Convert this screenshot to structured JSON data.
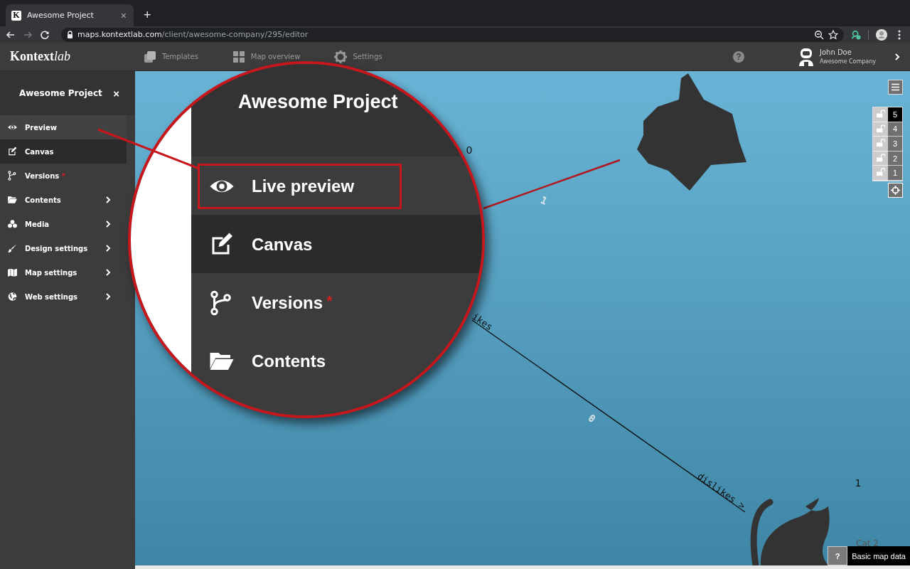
{
  "browser": {
    "tab": {
      "favicon": "K",
      "title": "Awesome Project",
      "close": "×"
    },
    "new_tab": "+",
    "forward_disabled": true,
    "url": {
      "host": "maps.kontextlab.com",
      "path": "/client/awesome-company/295/editor"
    }
  },
  "header": {
    "logo": {
      "main": "Kontext",
      "accent": "lab"
    },
    "nav": [
      {
        "label": "Templates"
      },
      {
        "label": "Map overview"
      },
      {
        "label": "Settings"
      }
    ],
    "help": "?",
    "user": {
      "name": "John Doe",
      "company": "Awesome Company"
    }
  },
  "sidebar": {
    "title": "Awesome Project",
    "close": "×",
    "items": [
      {
        "label": "Preview",
        "hovered": true,
        "selected": false,
        "submenu": false
      },
      {
        "label": "Canvas",
        "hovered": false,
        "selected": true,
        "submenu": false
      },
      {
        "label": "Versions",
        "badge": "*",
        "hovered": false,
        "selected": false,
        "submenu": false
      },
      {
        "label": "Contents",
        "hovered": false,
        "selected": false,
        "submenu": true
      },
      {
        "label": "Media",
        "hovered": false,
        "selected": false,
        "submenu": true
      },
      {
        "label": "Design settings",
        "hovered": false,
        "selected": false,
        "submenu": true
      },
      {
        "label": "Map settings",
        "hovered": false,
        "selected": false,
        "submenu": true
      },
      {
        "label": "Web settings",
        "hovered": false,
        "selected": false,
        "submenu": true
      }
    ]
  },
  "magnifier": {
    "title": "Awesome Project",
    "items": [
      {
        "label": "Live preview",
        "selected": false,
        "outlined": true
      },
      {
        "label": "Canvas",
        "selected": true,
        "outlined": false
      },
      {
        "label": "Versions",
        "badge": "*",
        "selected": false,
        "outlined": false
      },
      {
        "label": "Contents",
        "selected": false,
        "outlined": false
      }
    ]
  },
  "map": {
    "marks": [
      {
        "kind": "count",
        "text": "0"
      },
      {
        "kind": "edge-count",
        "text": "1"
      },
      {
        "kind": "edge-label",
        "text": "ikes"
      },
      {
        "kind": "edge-count",
        "text": "0"
      },
      {
        "kind": "edge-label",
        "text": "dislikes >"
      },
      {
        "kind": "count",
        "text": "1"
      },
      {
        "kind": "node-title",
        "text": "Cat 2"
      }
    ],
    "layers": [
      {
        "label": "5",
        "selected": true,
        "locked": false
      },
      {
        "label": "4",
        "selected": false,
        "locked": false
      },
      {
        "label": "3",
        "selected": false,
        "locked": false
      },
      {
        "label": "2",
        "selected": false,
        "locked": false
      },
      {
        "label": "1",
        "selected": false,
        "locked": false
      }
    ],
    "info": {
      "help": "?",
      "label": "Basic map data"
    }
  }
}
